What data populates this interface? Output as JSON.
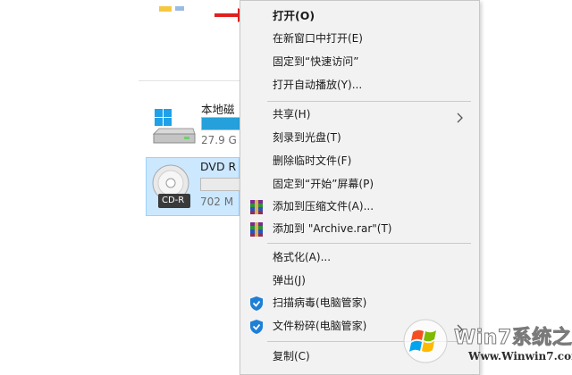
{
  "explorer": {
    "drives": [
      {
        "name": "本地磁",
        "size_text": "27.9 G",
        "used_fraction": 1.0
      },
      {
        "name": "DVD R",
        "size_text": "702 M",
        "disc_label": "CD-R",
        "used_fraction": 0.0,
        "selected": true
      }
    ]
  },
  "context_menu": {
    "items": [
      {
        "label": "打开(O)",
        "bold": true
      },
      {
        "label": "在新窗口中打开(E)"
      },
      {
        "label": "固定到“快速访问”"
      },
      {
        "label": "打开自动播放(Y)..."
      },
      {
        "label": "共享(H)",
        "submenu": true
      },
      {
        "label": "刻录到光盘(T)"
      },
      {
        "label": "删除临时文件(F)"
      },
      {
        "label": "固定到“开始”屏幕(P)"
      },
      {
        "label": "添加到压缩文件(A)...",
        "icon": "winrar-icon"
      },
      {
        "label": "添加到 \"Archive.rar\"(T)",
        "icon": "winrar-icon"
      },
      {
        "label": "格式化(A)..."
      },
      {
        "label": "弹出(J)"
      },
      {
        "label": "扫描病毒(电脑管家)",
        "icon": "shield-icon"
      },
      {
        "label": "文件粉碎(电脑管家)",
        "icon": "shield-icon",
        "submenu": true
      },
      {
        "label": "复制(C)"
      }
    ]
  },
  "watermark": {
    "title_part_a": "Win7",
    "title_part_b": "系统之家",
    "url": "Www.Winwin7.com"
  },
  "colors": {
    "menu_background": "#f2f2f2",
    "selection_background": "#cce8ff",
    "drive_bar_fill": "#26a0da",
    "arrow_red": "#e02020",
    "shield_blue": "#1e7fd6"
  }
}
